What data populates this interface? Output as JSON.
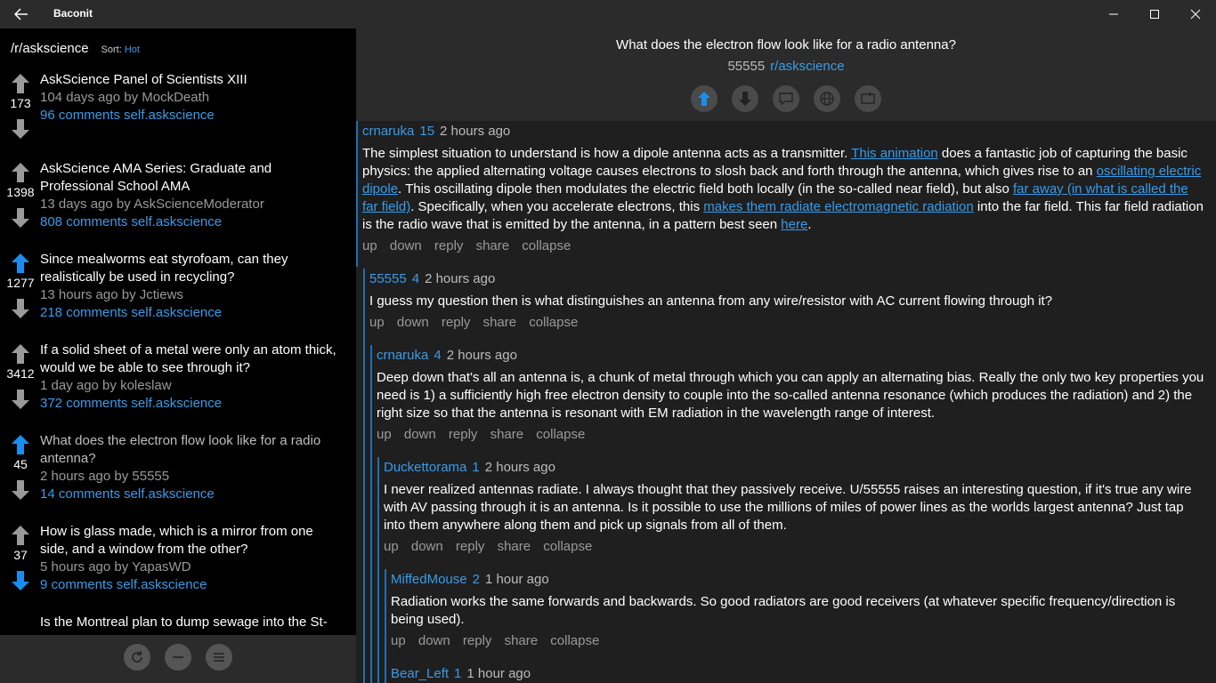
{
  "app": {
    "title": "Baconit"
  },
  "sidebar": {
    "subreddit": "/r/askscience",
    "sort_label": "Sort:",
    "sort_value": "Hot",
    "posts": [
      {
        "score": "173",
        "title": "AskScience Panel of Scientists XIII",
        "meta": "104 days ago by MockDeath",
        "comments": "96 comments",
        "domain": "self.askscience"
      },
      {
        "score": "1398",
        "title": "AskScience AMA Series: Graduate and Professional School AMA",
        "meta": "13 days ago by AskScienceModerator",
        "comments": "808 comments",
        "domain": "self.askscience"
      },
      {
        "score": "1277",
        "title": "Since mealworms eat styrofoam, can they realistically be used in recycling?",
        "meta": "13 hours ago by Jctiews",
        "comments": "218 comments",
        "domain": "self.askscience",
        "upvoted": true
      },
      {
        "score": "3412",
        "title": "If a solid sheet of a metal were only an atom thick, would we be able to see through it?",
        "meta": "1 day ago by koleslaw",
        "comments": "372 comments",
        "domain": "self.askscience"
      },
      {
        "score": "45",
        "title": "What does the electron flow look like for a radio antenna?",
        "meta": "2 hours ago by 55555",
        "comments": "14 comments",
        "domain": "self.askscience",
        "upvoted": true,
        "read": true
      },
      {
        "score": "37",
        "title": "How is glass made, which is a mirror from one side, and a window from the other?",
        "meta": "5 hours ago by YapasWD",
        "comments": "9 comments",
        "domain": "self.askscience",
        "downvoted": true
      },
      {
        "score": "",
        "title": "Is the Montreal plan to dump sewage into the St-",
        "meta": "",
        "comments": "",
        "domain": ""
      }
    ],
    "footer_icons": [
      "refresh-icon",
      "minus-icon",
      "menu-icon"
    ]
  },
  "post": {
    "title": "What does the electron flow look like for a radio antenna?",
    "score": "55555",
    "subreddit": "r/askscience",
    "actions": [
      "upvote-icon",
      "downvote-icon",
      "comment-icon",
      "globe-icon",
      "share-icon"
    ]
  },
  "comment_actions": {
    "up": "up",
    "down": "down",
    "reply": "reply",
    "share": "share",
    "collapse": "collapse"
  },
  "comments": [
    {
      "author": "crnaruka",
      "score": "15",
      "time": "2 hours ago",
      "parts": [
        {
          "t": "The simplest situation to understand is how a dipole antenna acts as a transmitter. "
        },
        {
          "t": "This animation",
          "link": true
        },
        {
          "t": " does a fantastic job of capturing the basic physics: the applied alternating voltage causes electrons to slosh back and forth through the antenna, which gives rise to an "
        },
        {
          "t": "oscillating electric dipole",
          "link": true
        },
        {
          "t": ". This oscillating dipole then modulates the electric field both locally (in the so-called near field), but also "
        },
        {
          "t": "far away (in what is called the far field)",
          "link": true
        },
        {
          "t": ". Specifically, when you accelerate electrons, this "
        },
        {
          "t": "makes them radiate electromagnetic radiation",
          "link": true
        },
        {
          "t": " into the far field. This far field radiation is the radio wave that is emitted by the antenna, in a pattern best seen "
        },
        {
          "t": "here",
          "link": true
        },
        {
          "t": "."
        }
      ]
    },
    {
      "author": "55555",
      "score": "4",
      "time": "2 hours ago",
      "parts": [
        {
          "t": "I guess my question then is what distinguishes an antenna from any wire/resistor with AC current flowing through it?"
        }
      ]
    },
    {
      "author": "crnaruka",
      "score": "4",
      "time": "2 hours ago",
      "parts": [
        {
          "t": "Deep down that's all an antenna is, a chunk of metal through which you can apply an alternating bias. Really the only two key properties you need is 1) a sufficiently high free electron density to couple into the so-called antenna resonance (which produces the radiation) and 2) the right size so that the antenna is resonant with EM radiation in the wavelength range of interest."
        }
      ]
    },
    {
      "author": "Duckettorama",
      "score": "1",
      "time": "2 hours ago",
      "parts": [
        {
          "t": "I never realized antennas radiate. I always thought that they passively receive. U/55555 raises an interesting question, if it's true any wire with AV passing through it is an antenna. Is it possible to use the millions of miles of power lines as the worlds largest antenna? Just tap into them anywhere along them and pick up signals from all of them."
        }
      ]
    },
    {
      "author": "MiffedMouse",
      "score": "2",
      "time": "1 hour ago",
      "parts": [
        {
          "t": "Radiation works the same forwards and backwards. So good radiators are good receivers (at whatever specific frequency/direction is being used)."
        }
      ]
    },
    {
      "author": "Bear_Left",
      "score": "1",
      "time": "1 hour ago",
      "parts": []
    }
  ]
}
